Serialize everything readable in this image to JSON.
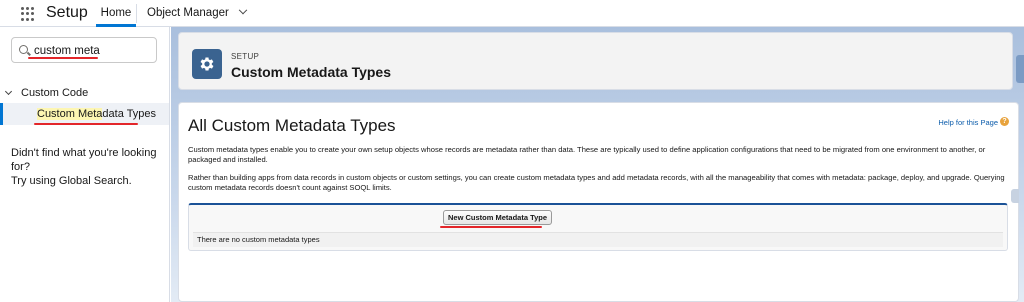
{
  "topnav": {
    "app_name": "Setup",
    "tabs": [
      {
        "label": "Home",
        "active": true
      },
      {
        "label": "Object Manager",
        "active": false
      }
    ]
  },
  "sidebar": {
    "search": {
      "value": "custom meta"
    },
    "tree": {
      "group_label": "Custom Code",
      "item": {
        "prefix": "",
        "highlight": "Custom Meta",
        "suffix": "data Types"
      }
    },
    "not_found": {
      "line1": "Didn't find what you're looking for?",
      "line2": "Try using Global Search."
    }
  },
  "header": {
    "eyebrow": "SETUP",
    "title": "Custom Metadata Types",
    "icon": "gear-icon"
  },
  "content": {
    "page_title": "All Custom Metadata Types",
    "help_link": "Help for this Page",
    "paragraph1": "Custom metadata types enable you to create your own setup objects whose records are metadata rather than data. These are typically used to define application configurations that need to be migrated from one environment to another, or packaged and installed.",
    "paragraph2": "Rather than building apps from data records in custom objects or custom settings, you can create custom metadata types and add metadata records, with all the manageability that comes with metadata: package, deploy, and upgrade. Querying custom metadata records doesn't count against SOQL limits.",
    "new_button": "New Custom Metadata Type",
    "empty_message": "There are no custom metadata types"
  },
  "colors": {
    "accent": "#0176d3",
    "header_icon_bg": "#3a6390",
    "annotation_red": "#e3262a",
    "search_highlight": "#fdf6b2"
  }
}
